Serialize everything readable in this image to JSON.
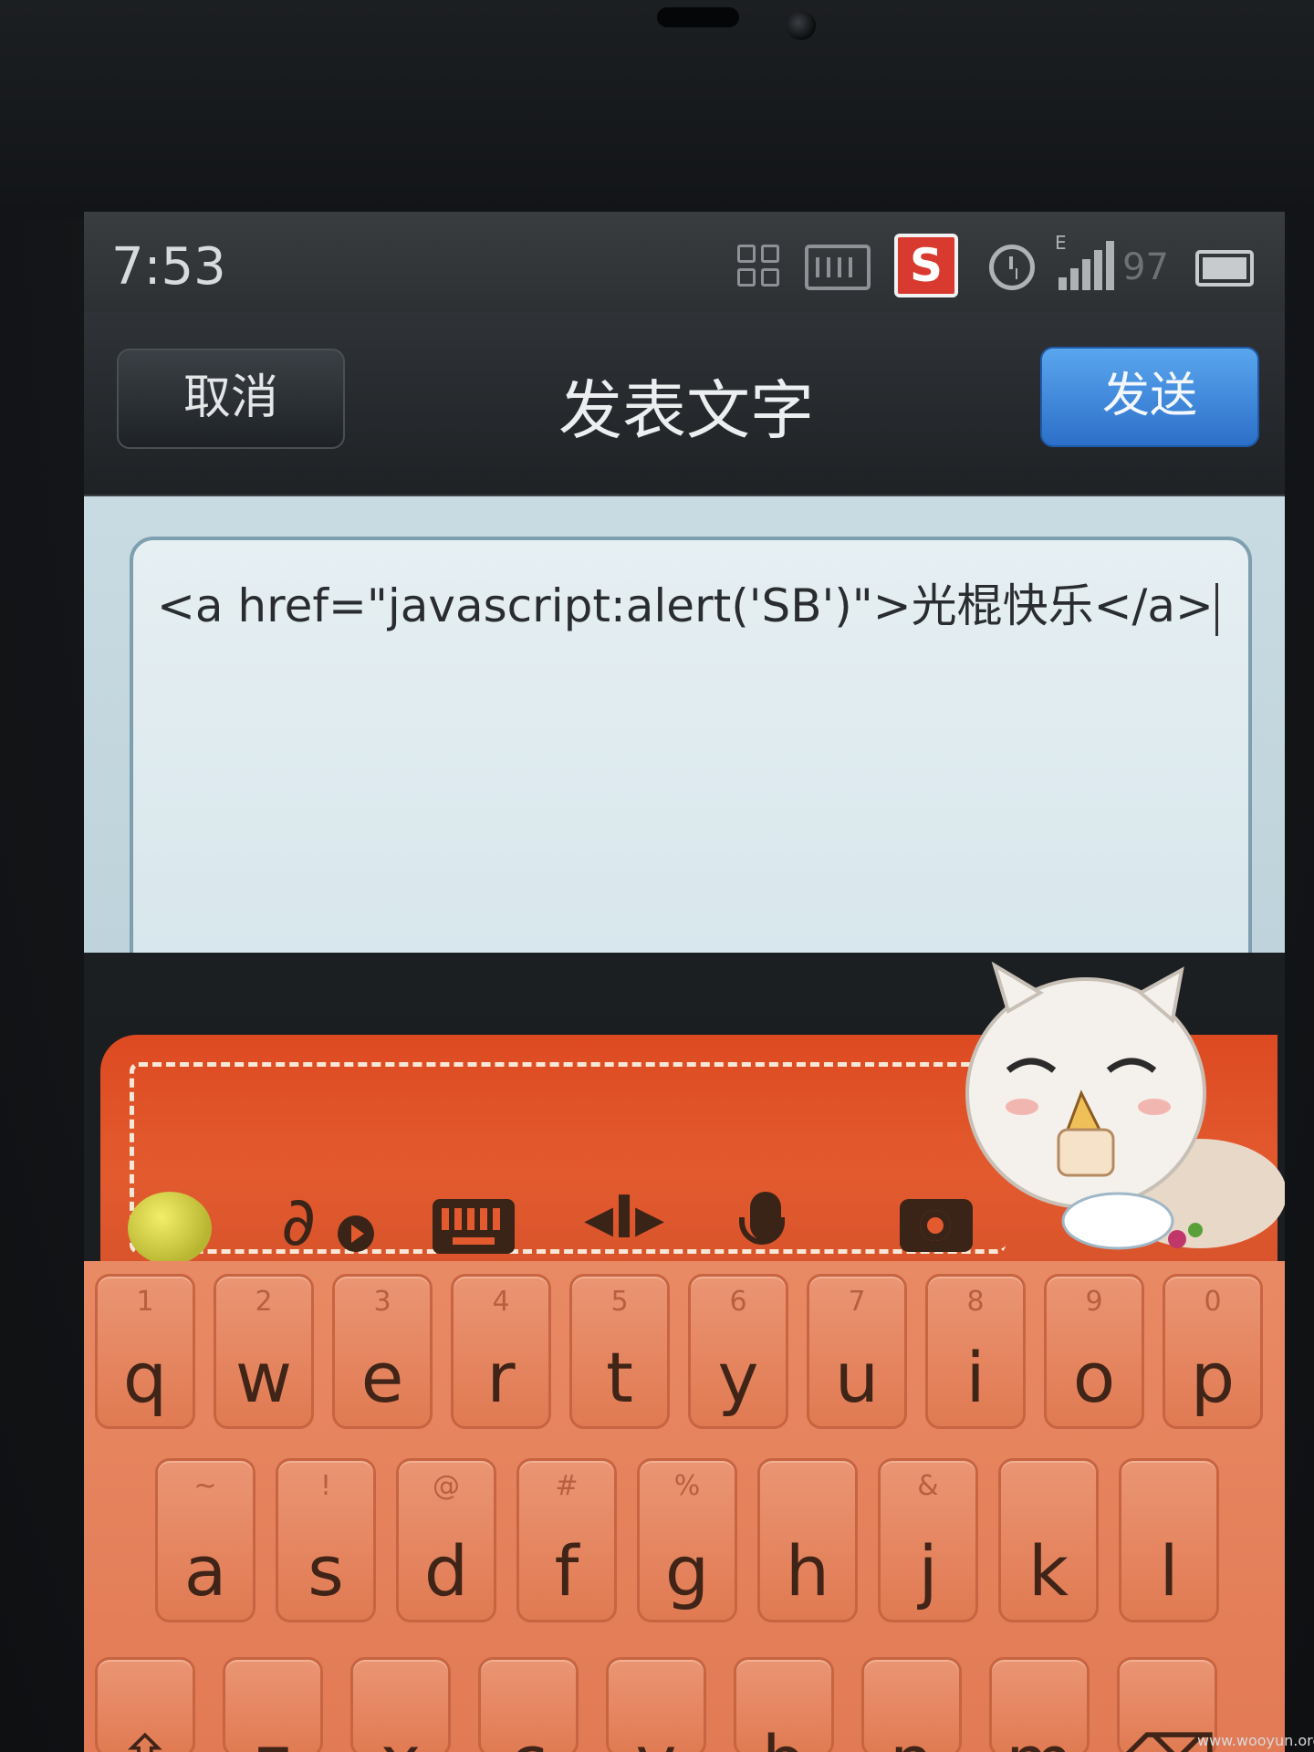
{
  "status_bar": {
    "time": "7:53",
    "s_app_icon": "S",
    "network_label": "E",
    "battery_percent": "97",
    "icons": [
      "grid-icon",
      "keyboard-status-icon",
      "s-app-icon",
      "alarm-icon",
      "signal-icon",
      "battery-icon"
    ]
  },
  "header": {
    "cancel_label": "取消",
    "title": "发表文字",
    "send_label": "发送"
  },
  "compose": {
    "text": "<a href=\"javascript:alert('SB')\">光棍快乐</a>"
  },
  "toolbar": {
    "icons": [
      "attach-icon",
      "keyboard-icon",
      "cursor-move-icon",
      "microphone-icon",
      "camera-icon"
    ],
    "accent_color": "#e35a2e"
  },
  "keyboard": {
    "row1": [
      {
        "hint": "1",
        "key": "q"
      },
      {
        "hint": "2",
        "key": "w"
      },
      {
        "hint": "3",
        "key": "e"
      },
      {
        "hint": "4",
        "key": "r"
      },
      {
        "hint": "5",
        "key": "t"
      },
      {
        "hint": "6",
        "key": "y"
      },
      {
        "hint": "7",
        "key": "u"
      },
      {
        "hint": "8",
        "key": "i"
      },
      {
        "hint": "9",
        "key": "o"
      },
      {
        "hint": "0",
        "key": "p"
      }
    ],
    "row2": [
      {
        "hint": "~",
        "key": "a"
      },
      {
        "hint": "!",
        "key": "s"
      },
      {
        "hint": "@",
        "key": "d"
      },
      {
        "hint": "#",
        "key": "f"
      },
      {
        "hint": "%",
        "key": "g"
      },
      {
        "hint": "",
        "key": "h"
      },
      {
        "hint": "&",
        "key": "j"
      },
      {
        "hint": "",
        "key": "k"
      },
      {
        "hint": "",
        "key": "l"
      }
    ],
    "row3": [
      {
        "hint": "",
        "key": "⇧"
      },
      {
        "hint": "",
        "key": "z"
      },
      {
        "hint": "",
        "key": "x"
      },
      {
        "hint": "",
        "key": "c"
      },
      {
        "hint": "",
        "key": "v"
      },
      {
        "hint": "",
        "key": "b"
      },
      {
        "hint": "",
        "key": "n"
      },
      {
        "hint": "",
        "key": "m"
      },
      {
        "hint": "",
        "key": "⌫"
      }
    ],
    "key_color": "#e88a64"
  },
  "watermark": "www.wooyun.org"
}
